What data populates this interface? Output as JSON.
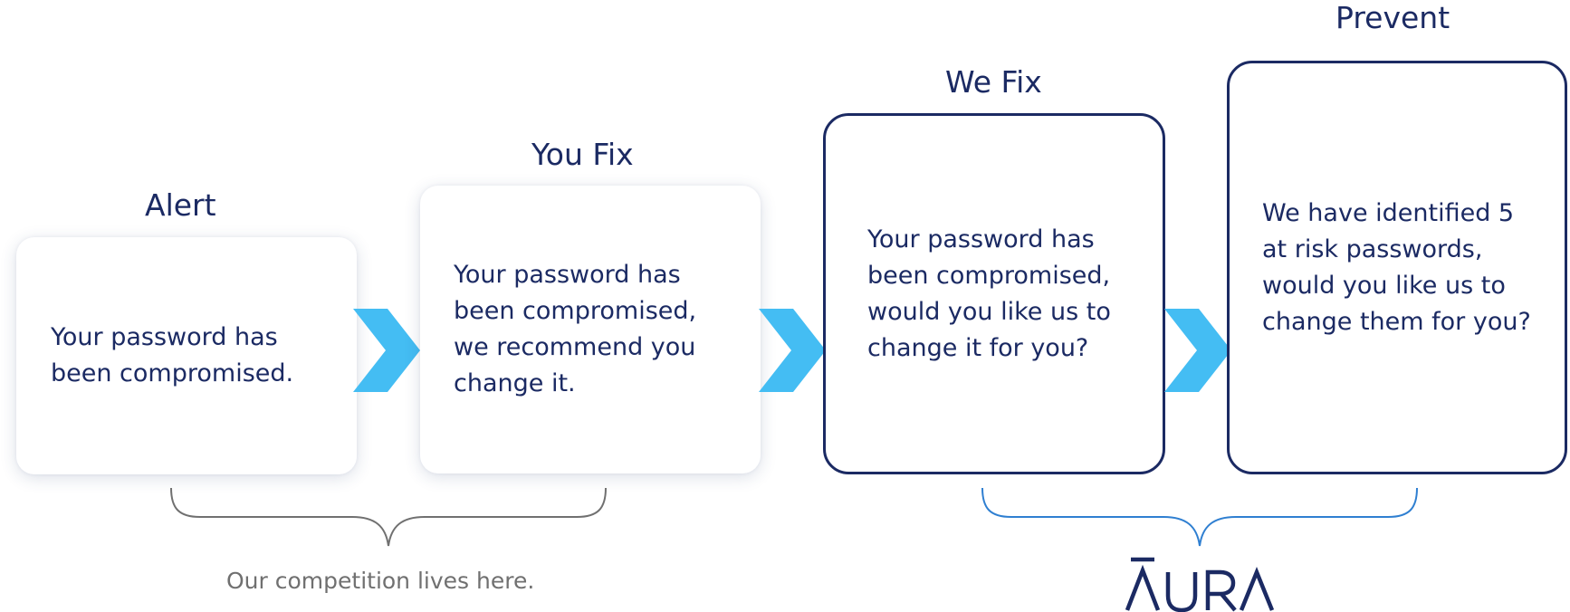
{
  "stages": [
    {
      "title": "Alert",
      "text": "Your password has\nbeen compromised."
    },
    {
      "title": "You Fix",
      "text": "Your password has\nbeen compromised,\nwe recommend you\nchange it."
    },
    {
      "title": "We Fix",
      "text": "Your password has\nbeen compromised,\nwould you like us to\nchange it for you?"
    },
    {
      "title": "Prevent",
      "text": "We have identified 5\nat risk passwords,\nwould you like us to\nchange them for you?"
    }
  ],
  "captions": {
    "competition": "Our competition lives here."
  },
  "brand": {
    "logo_text": "AURA"
  },
  "colors": {
    "navy": "#1b2a63",
    "chevron": "#44bdf3",
    "brace_gray": "#707070",
    "brace_blue": "#2f7fd1"
  },
  "icons": [
    "chevron-right-icon",
    "chevron-right-icon",
    "chevron-right-icon",
    "curly-brace-icon",
    "curly-brace-icon",
    "aura-logo-icon"
  ]
}
